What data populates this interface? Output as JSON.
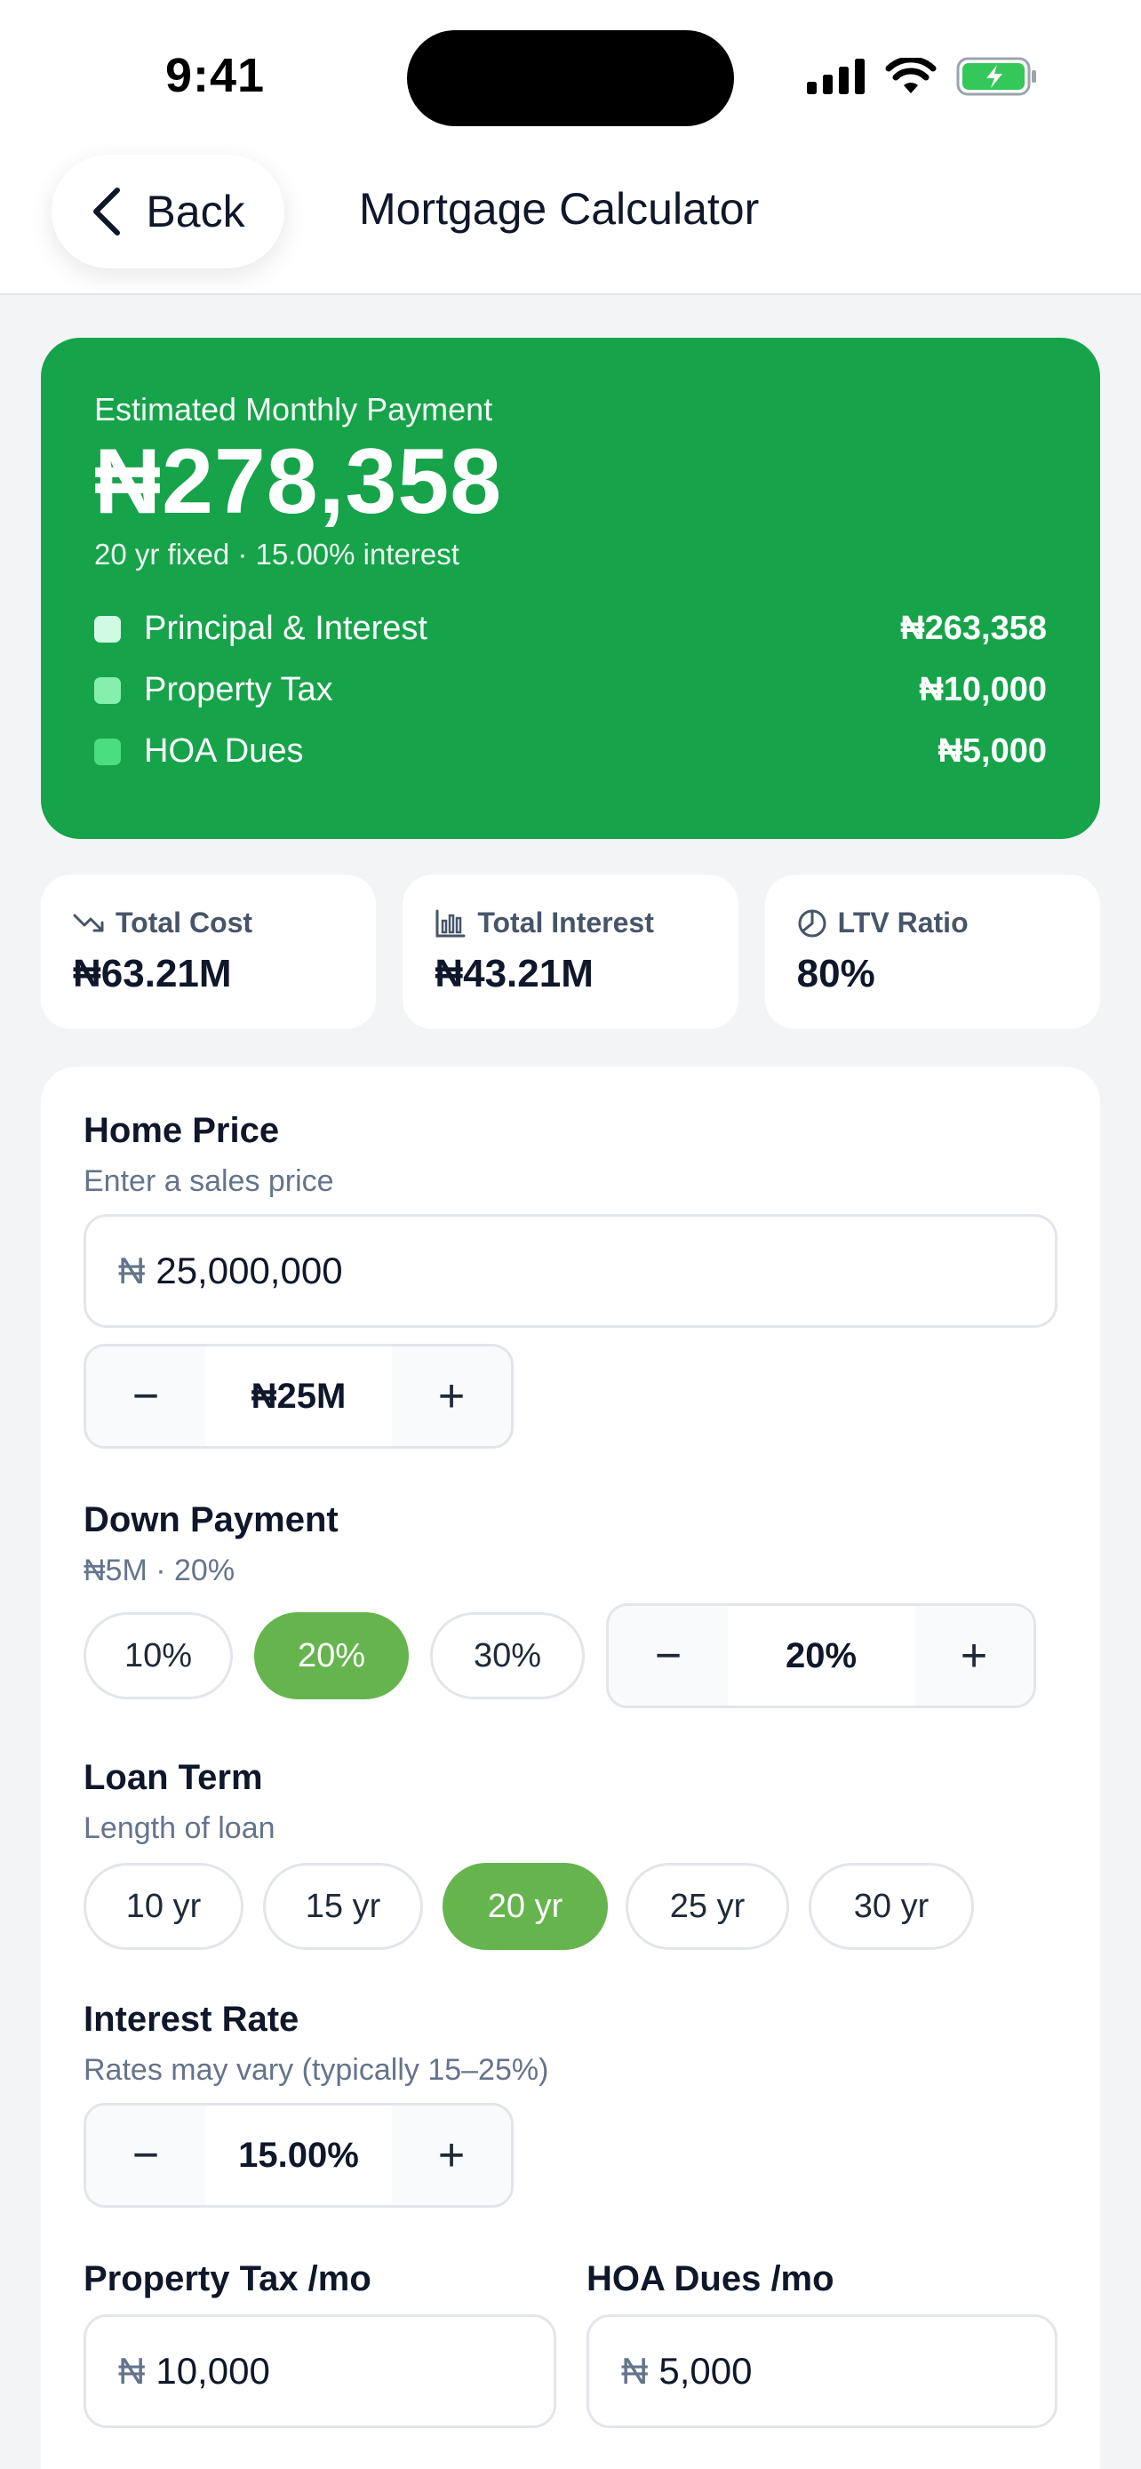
{
  "status": {
    "time": "9:41"
  },
  "nav": {
    "back_label": "Back",
    "title": "Mortgage Calculator"
  },
  "summary": {
    "label": "Estimated Monthly Payment",
    "amount": "₦278,358",
    "sub": "20 yr fixed · 15.00% interest",
    "breakdown": [
      {
        "label": "Principal & Interest",
        "value": "₦263,358",
        "color": "#d1fae5"
      },
      {
        "label": "Property Tax",
        "value": "₦10,000",
        "color": "#86efac"
      },
      {
        "label": "HOA Dues",
        "value": "₦5,000",
        "color": "#4ade80"
      }
    ]
  },
  "stats": [
    {
      "label": "Total Cost",
      "value": "₦63.21M",
      "icon": "trending-down-icon"
    },
    {
      "label": "Total Interest",
      "value": "₦43.21M",
      "icon": "bar-chart-icon"
    },
    {
      "label": "LTV Ratio",
      "value": "80%",
      "icon": "pie-chart-icon"
    }
  ],
  "form": {
    "home_price": {
      "label": "Home Price",
      "hint": "Enter a sales price",
      "currency": "₦",
      "value": "25,000,000",
      "stepper_value": "₦25M"
    },
    "down_payment": {
      "label": "Down Payment",
      "hint": "₦5M · 20%",
      "options": [
        "10%",
        "20%",
        "30%"
      ],
      "selected": "20%",
      "stepper_value": "20%"
    },
    "loan_term": {
      "label": "Loan Term",
      "hint": "Length of loan",
      "options": [
        "10 yr",
        "15 yr",
        "20 yr",
        "25 yr",
        "30 yr"
      ],
      "selected": "20 yr"
    },
    "interest_rate": {
      "label": "Interest Rate",
      "hint": "Rates may vary (typically 15–25%)",
      "stepper_value": "15.00%"
    },
    "property_tax": {
      "label": "Property Tax /mo",
      "currency": "₦",
      "value": "10,000"
    },
    "hoa_dues": {
      "label": "HOA Dues /mo",
      "currency": "₦",
      "value": "5,000"
    }
  },
  "colors": {
    "accent": "#16a34a",
    "chip_active": "#66b44e"
  },
  "stepper_symbols": {
    "minus": "−",
    "plus": "+"
  }
}
